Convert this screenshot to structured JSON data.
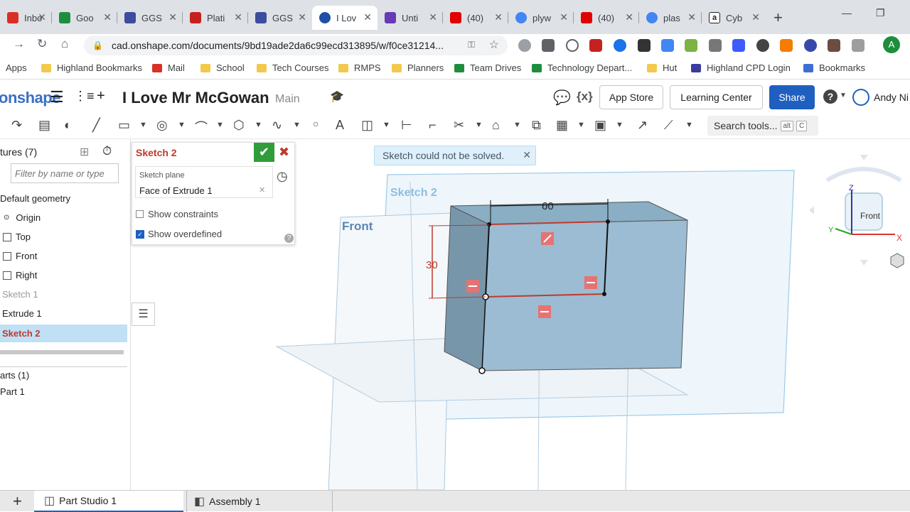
{
  "browser": {
    "tabs": [
      {
        "label": "Inbo",
        "color": "#d93025"
      },
      {
        "label": "Goo",
        "color": "#1e8e3e"
      },
      {
        "label": "GGS",
        "color": "#3c4c9e"
      },
      {
        "label": "Plati",
        "color": "#c5221f"
      },
      {
        "label": "GGS",
        "color": "#3c4c9e"
      },
      {
        "label": "I Lov",
        "color": "#1f4fa6"
      },
      {
        "label": "Unti",
        "color": "#673ab7"
      },
      {
        "label": "(40)",
        "color": "#e00000"
      },
      {
        "label": "plyw",
        "color": "#4285f4"
      },
      {
        "label": "(40)",
        "color": "#e00000"
      },
      {
        "label": "plas",
        "color": "#4285f4"
      },
      {
        "label": "Cyb",
        "color": "#222222"
      }
    ],
    "url": "cad.onshape.com/documents/9bd19ade2da6c99ecd313895/w/f0ce31214...",
    "profile_initial": "A"
  },
  "bookmarks": [
    {
      "label": "Apps",
      "color": "#4285f4"
    },
    {
      "label": "Highland Bookmarks",
      "color": "#f2c94c"
    },
    {
      "label": "Mail",
      "color": "#d93025"
    },
    {
      "label": "School",
      "color": "#f2c94c"
    },
    {
      "label": "Tech Courses",
      "color": "#f2c94c"
    },
    {
      "label": "RMPS",
      "color": "#f2c94c"
    },
    {
      "label": "Planners",
      "color": "#f2c94c"
    },
    {
      "label": "Team Drives",
      "color": "#1e8e3e"
    },
    {
      "label": "Technology Depart...",
      "color": "#1e8e3e"
    },
    {
      "label": "Hut",
      "color": "#f2c94c"
    },
    {
      "label": "Highland CPD  Login",
      "color": "#3c3ca0"
    },
    {
      "label": "Bookmarks",
      "color": "#3c6fd1"
    }
  ],
  "header": {
    "logo": "onshape",
    "doc_title": "I Love Mr McGowan",
    "branch": "Main",
    "app_store": "App Store",
    "learning_center": "Learning Center",
    "share": "Share",
    "help": "?",
    "user": "Andy Ni"
  },
  "toolbar": {
    "search_label": "Search tools...",
    "kbd1": "alt",
    "kbd2": "C"
  },
  "features": {
    "title": "tures (7)",
    "filter_placeholder": "Filter by name or type",
    "default_geometry": "Default geometry",
    "items": [
      "Origin",
      "Top",
      "Front",
      "Right",
      "Sketch 1",
      "Extrude 1",
      "Sketch 2"
    ],
    "parts_header": "arts (1)",
    "part1": "Part 1"
  },
  "sketch_dialog": {
    "title": "Sketch 2",
    "plane_label": "Sketch plane",
    "plane_value": "Face of Extrude 1",
    "show_constraints": "Show constraints",
    "show_overdefined": "Show overdefined",
    "constraints_checked": false,
    "overdefined_checked": true
  },
  "viewport": {
    "error_message": "Sketch could not be solved.",
    "sketch_label": "Sketch 2",
    "front_label": "Front",
    "dim_width": "60",
    "dim_height": "30",
    "cube_face": "Front",
    "axis_z": "Z",
    "axis_x": "X",
    "axis_y": "Y"
  },
  "bottom_tabs": [
    "Part Studio 1",
    "Assembly 1"
  ]
}
